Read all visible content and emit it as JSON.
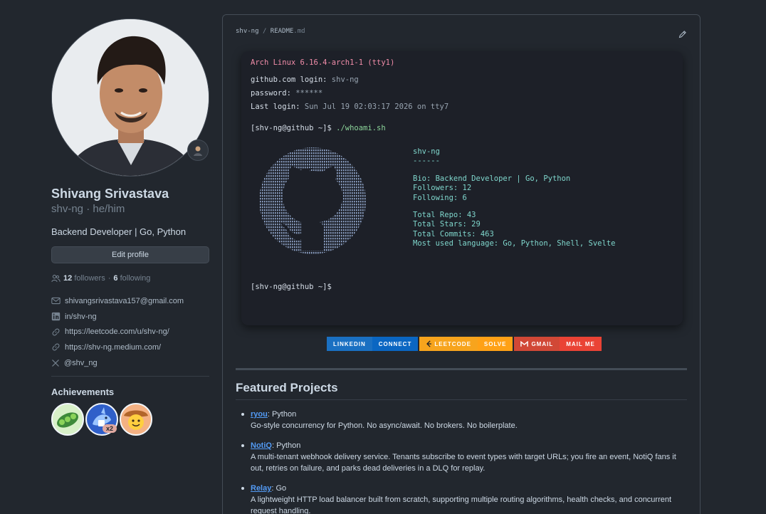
{
  "profile": {
    "name": "Shivang Srivastava",
    "handle": "shv-ng · he/him",
    "bio": "Backend Developer | Go, Python",
    "edit_label": "Edit profile",
    "followers_count": "12",
    "followers_label": "followers",
    "following_sep": "·",
    "following_count": "6",
    "following_label": "following",
    "links": [
      {
        "icon": "mail-icon",
        "text": "shivangsrivastava157@gmail.com"
      },
      {
        "icon": "linkedin-icon",
        "text": "in/shv-ng"
      },
      {
        "icon": "link-icon",
        "text": "https://leetcode.com/u/shv-ng/"
      },
      {
        "icon": "link-icon",
        "text": "https://shv-ng.medium.com/"
      },
      {
        "icon": "x-icon",
        "text": "@shv_ng"
      }
    ],
    "achievements_title": "Achievements",
    "badge_multiplier": "x2"
  },
  "readme": {
    "repo": "shv-ng",
    "sep": "/",
    "file": "README",
    "ext": ".md"
  },
  "terminal": {
    "banner": "Arch Linux 6.16.4-arch1-1 (tty1)",
    "login_label": "github.com login:",
    "login_value": "shv-ng",
    "password_label": "password:",
    "password_value": "******",
    "last_login_label": "Last login:",
    "last_login_value": "Sun Jul 19 02:03:17 2026 on tty7",
    "prompt": "[shv-ng@github ~]$",
    "command": "./whoami.sh",
    "info": {
      "user": "shv-ng",
      "underline": "------",
      "bio": "Bio: Backend Developer | Go, Python",
      "followers": "Followers: 12",
      "following": "Following: 6",
      "repos": "Total Repo: 43",
      "stars": "Total Stars: 29",
      "commits": "Total Commits: 463",
      "languages": "Most used language: Go, Python, Shell, Svelte"
    },
    "final_prompt": "[shv-ng@github ~]$"
  },
  "shields": [
    {
      "label": "LINKEDIN",
      "message": "CONNECT",
      "label_color": "#1a70c2",
      "msg_color": "#0a66c2"
    },
    {
      "label": "LEETCODE",
      "message": "SOLVE",
      "label_color": "#f7a41d",
      "msg_color": "#ffa116"
    },
    {
      "label": "GMAIL",
      "message": "MAIL ME",
      "label_color": "#d14836",
      "msg_color": "#ea4335"
    }
  ],
  "featured": {
    "title": "Featured Projects",
    "projects": [
      {
        "name": "ryou",
        "lang": ": Python",
        "desc": "Go-style concurrency for Python. No async/await. No brokers. No boilerplate."
      },
      {
        "name": "NotiQ",
        "lang": ": Python",
        "desc": "A multi-tenant webhook delivery service. Tenants subscribe to event types with target URLs; you fire an event, NotiQ fans it out, retries on failure, and parks dead deliveries in a DLQ for replay."
      },
      {
        "name": "Relay",
        "lang": ": Go",
        "desc": "A lightweight HTTP load balancer built from scratch, supporting multiple routing algorithms, health checks, and concurrent request handling."
      }
    ]
  }
}
